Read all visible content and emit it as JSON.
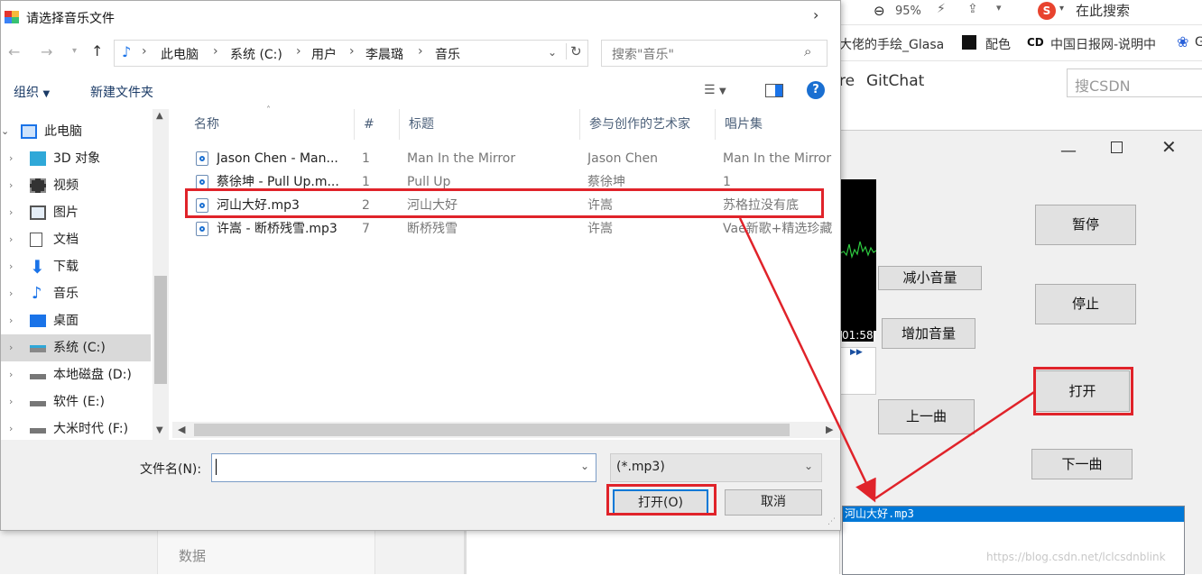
{
  "browser": {
    "zoom": "95%",
    "search_placeholder": "在此搜索",
    "bookmarks": [
      "大佬的手绘_Glasa",
      "配色",
      "中国日报网-说明中",
      "G"
    ],
    "csdn_nav": [
      "re",
      "GitChat"
    ],
    "csdn_search_placeholder": "搜CSDN",
    "left_strip_text": "数据",
    "watermark": "https://blog.csdn.net/lclcsdnblink"
  },
  "music_app": {
    "time": "01:58",
    "buttons": {
      "pause": "暂停",
      "volume_down": "减小音量",
      "volume_up": "增加音量",
      "stop": "停止",
      "open": "打开",
      "prev": "上一曲",
      "next": "下一曲"
    },
    "playlist": [
      "河山大好.mp3"
    ]
  },
  "dialog": {
    "title": "请选择音乐文件",
    "breadcrumb": [
      "此电脑",
      "系统 (C:)",
      "用户",
      "李晨璐",
      "音乐"
    ],
    "search_placeholder": "搜索\"音乐\"",
    "toolbar": {
      "organize": "组织",
      "new_folder": "新建文件夹"
    },
    "nav_items": [
      {
        "label": "此电脑",
        "icon": "pc-icon"
      },
      {
        "label": "3D 对象",
        "icon": "cube-icon"
      },
      {
        "label": "视频",
        "icon": "film-icon"
      },
      {
        "label": "图片",
        "icon": "picture-icon"
      },
      {
        "label": "文档",
        "icon": "document-icon"
      },
      {
        "label": "下载",
        "icon": "download-icon"
      },
      {
        "label": "音乐",
        "icon": "music-note-icon"
      },
      {
        "label": "桌面",
        "icon": "desktop-icon"
      },
      {
        "label": "系统 (C:)",
        "icon": "system-drive-icon"
      },
      {
        "label": "本地磁盘 (D:)",
        "icon": "drive-icon"
      },
      {
        "label": "软件 (E:)",
        "icon": "drive-icon"
      },
      {
        "label": "大米时代 (F:)",
        "icon": "drive-icon"
      }
    ],
    "columns": [
      "名称",
      "#",
      "标题",
      "参与创作的艺术家",
      "唱片集"
    ],
    "files": [
      {
        "name": "Jason Chen - Man...",
        "num": "1",
        "title": "Man In the Mirror",
        "artist": "Jason Chen",
        "album": "Man In the Mirror"
      },
      {
        "name": "蔡徐坤 - Pull Up.m...",
        "num": "1",
        "title": "Pull Up",
        "artist": "蔡徐坤",
        "album": "1"
      },
      {
        "name": "河山大好.mp3",
        "num": "2",
        "title": "河山大好",
        "artist": "许嵩",
        "album": "苏格拉没有底"
      },
      {
        "name": "许嵩 - 断桥残雪.mp3",
        "num": "7",
        "title": "断桥残雪",
        "artist": "许嵩",
        "album": "Vae新歌+精选珍藏"
      }
    ],
    "filename_label": "文件名(N):",
    "filename_value": "",
    "filter": "(*.mp3)",
    "open_button": "打开(O)",
    "cancel_button": "取消"
  },
  "colors": {
    "highlight": "#e0232a",
    "selection": "#0078d7"
  }
}
